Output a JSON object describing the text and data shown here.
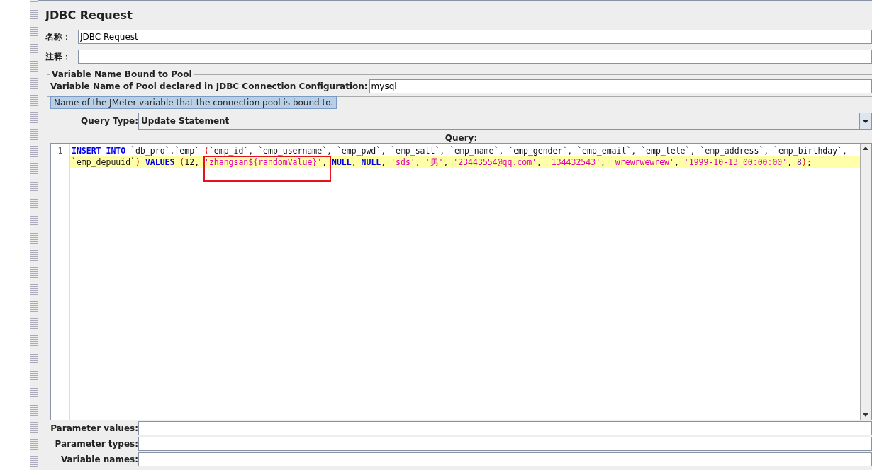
{
  "title": "JDBC Request",
  "fields": [
    {
      "label": "名称：",
      "value": "JDBC Request"
    },
    {
      "label": "注释："
    }
  ],
  "pool_group": {
    "legend": "Variable Name Bound to Pool",
    "label": "Variable Name of Pool declared in JDBC Connection Configuration:",
    "value": "mysql"
  },
  "tooltip": "Name of the JMeter variable that the connection pool is bound to.",
  "query_type": {
    "label": "Query Type:",
    "value": "Update Statement"
  },
  "query": {
    "label": "Query:",
    "lines": [
      {
        "number": "1",
        "rows": [
          {
            "highlighted": false,
            "tokens": [
              {
                "kind": "keyword",
                "text": "INSERT INTO"
              },
              {
                "kind": "plain",
                "text": " `db_pro`.`emp` "
              },
              {
                "kind": "paren",
                "text": "("
              },
              {
                "kind": "plain",
                "text": "`emp_id`, `emp_username`, `emp_pwd`, `emp_salt`, `emp_name`, `emp_gender`, `emp_email`, `emp_tele`, `emp_address`, `emp_birthday`,"
              }
            ]
          },
          {
            "highlighted": true,
            "tokens": [
              {
                "kind": "plain",
                "text": "`emp_depuuid`"
              },
              {
                "kind": "paren",
                "text": ") "
              },
              {
                "kind": "keyword",
                "text": "VALUES"
              },
              {
                "kind": "paren",
                "text": " ("
              },
              {
                "kind": "plain",
                "text": "12, "
              },
              {
                "kind": "string",
                "text": "'zhangsan${randomValue}'"
              },
              {
                "kind": "plain",
                "text": ", "
              },
              {
                "kind": "keyword",
                "text": "NULL"
              },
              {
                "kind": "plain",
                "text": ", "
              },
              {
                "kind": "keyword",
                "text": "NULL"
              },
              {
                "kind": "plain",
                "text": ", "
              },
              {
                "kind": "string",
                "text": "'sds'"
              },
              {
                "kind": "plain",
                "text": ", "
              },
              {
                "kind": "string",
                "text": "'男'"
              },
              {
                "kind": "plain",
                "text": ", "
              },
              {
                "kind": "string",
                "text": "'23443554@qq.com'"
              },
              {
                "kind": "plain",
                "text": ", "
              },
              {
                "kind": "string",
                "text": "'134432543'"
              },
              {
                "kind": "plain",
                "text": ", "
              },
              {
                "kind": "string",
                "text": "'wrewrwewrew'"
              },
              {
                "kind": "plain",
                "text": ", "
              },
              {
                "kind": "string",
                "text": "'1999-10-13 00:00:00'"
              },
              {
                "kind": "plain",
                "text": ", "
              },
              {
                "kind": "number",
                "text": "8"
              },
              {
                "kind": "paren",
                "text": ")"
              },
              {
                "kind": "plain",
                "text": ";"
              }
            ]
          }
        ]
      }
    ]
  },
  "parameters": [
    {
      "label": "Parameter values:"
    },
    {
      "label": "Parameter types:"
    },
    {
      "label": "Variable names:"
    }
  ]
}
